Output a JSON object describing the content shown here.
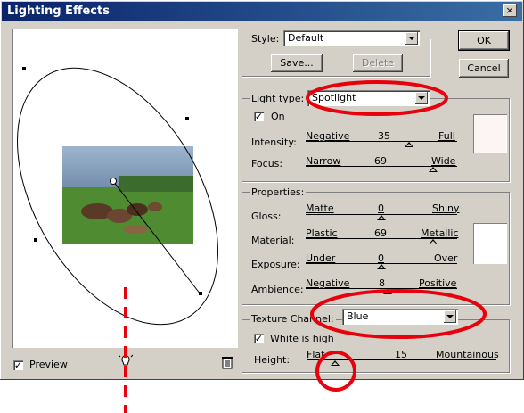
{
  "dialog": {
    "title": "Lighting Effects",
    "close_label": "×"
  },
  "buttons": {
    "ok": "OK",
    "cancel": "Cancel",
    "save": "Save...",
    "delete": "Delete"
  },
  "style": {
    "label": "Style:",
    "value": "Default"
  },
  "light": {
    "type_label": "Light type:",
    "type_value": "Spotlight",
    "on_label": "On",
    "on_checked": true,
    "intensity": {
      "label": "Intensity:",
      "min": "Negative",
      "value": "35",
      "max": "Full",
      "level": 0.68
    },
    "focus": {
      "label": "Focus:",
      "min": "Narrow",
      "value": "69",
      "max": "Wide",
      "level": 0.84
    },
    "color": "#fdf5f3"
  },
  "properties": {
    "group_label": "Properties:",
    "gloss": {
      "label": "Gloss:",
      "min": "Matte",
      "value": "0",
      "max": "Shiny",
      "level": 0.5
    },
    "material": {
      "label": "Material:",
      "min": "Plastic",
      "value": "69",
      "max": "Metallic",
      "level": 0.84
    },
    "exposure": {
      "label": "Exposure:",
      "min": "Under",
      "value": "0",
      "max": "Over",
      "level": 0.5
    },
    "ambience": {
      "label": "Ambience:",
      "min": "Negative",
      "value": "8",
      "max": "Positive",
      "level": 0.54
    },
    "color": "#ffffff"
  },
  "texture": {
    "channel_label": "Texture Channel:",
    "channel_value": "Blue",
    "white_high_label": "White is high",
    "white_high_checked": true,
    "height": {
      "label": "Height:",
      "min": "Flat",
      "value": "15",
      "max": "Mountainous",
      "level": 0.15
    }
  },
  "preview": {
    "label": "Preview",
    "checked": true
  },
  "annotations": {
    "highlight_color": "#e8000d"
  }
}
